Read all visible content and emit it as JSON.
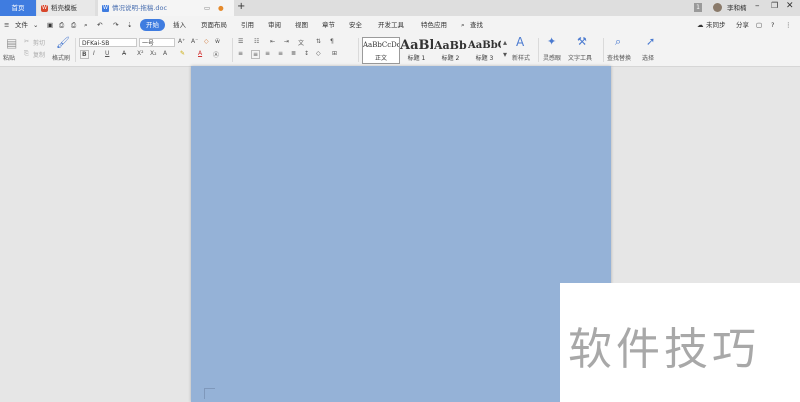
{
  "titlebar": {
    "tabs": [
      {
        "label": "首页"
      },
      {
        "label": "稻壳模板"
      },
      {
        "label": "情况说明-拖稿.doc"
      }
    ],
    "page_badge": "1",
    "user_name": "李和楠"
  },
  "menubar": {
    "file_label": "文件",
    "items": [
      "开始",
      "插入",
      "页面布局",
      "引用",
      "审阅",
      "视图",
      "章节",
      "安全",
      "开发工具",
      "特色应用"
    ],
    "search_label": "查找",
    "sync_label": "未同步",
    "share_label": "分享"
  },
  "toolbar": {
    "paste_label": "粘贴",
    "cut_label": "剪切",
    "copy_label": "复制",
    "format_painter_label": "格式刷",
    "font_name": "DFKai-SB",
    "font_size": "一号",
    "styles": [
      {
        "sample": "AaBbCcDd",
        "name": "正文"
      },
      {
        "sample": "AaBl",
        "name": "标题 1"
      },
      {
        "sample": "AaBb(",
        "name": "标题 2"
      },
      {
        "sample": "AaBbC",
        "name": "标题 3"
      }
    ],
    "new_style_label": "新样式",
    "lingxi_label": "灵感眼",
    "text_tools_label": "文字工具",
    "find_replace_label": "查找替换",
    "select_label": "选择"
  },
  "watermark": {
    "text": "软件技巧"
  }
}
